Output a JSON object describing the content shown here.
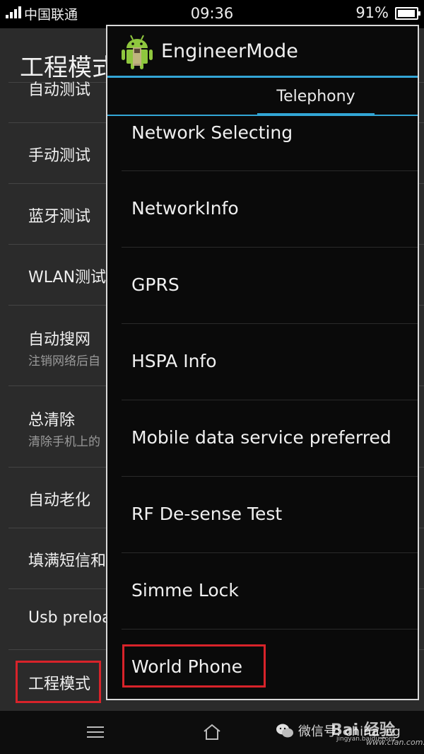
{
  "status_bar": {
    "carrier": "中国联通",
    "time": "09:36",
    "battery": "91%"
  },
  "background_app": {
    "title": "工程模式",
    "items": [
      {
        "label": "自动测试",
        "sub": ""
      },
      {
        "label": "手动测试",
        "sub": ""
      },
      {
        "label": "蓝牙测试",
        "sub": ""
      },
      {
        "label": "WLAN测试",
        "sub": ""
      },
      {
        "label": "自动搜网",
        "sub": "注销网络后自"
      },
      {
        "label": "总清除",
        "sub": "清除手机上的"
      },
      {
        "label": "自动老化",
        "sub": ""
      },
      {
        "label": "填满短信和",
        "sub": ""
      },
      {
        "label": "Usb preloa",
        "sub": ""
      },
      {
        "label": "工程模式",
        "sub": ""
      }
    ]
  },
  "dialog": {
    "title": "EngineerMode",
    "app_icon": "android-robot-icon",
    "tab": "Telephony",
    "items": [
      "Network Selecting",
      "NetworkInfo",
      "GPRS",
      "HSPA Info",
      "Mobile data service preferred",
      "RF De-sense Test",
      "Simme Lock",
      "World Phone"
    ]
  },
  "nav_bar": {
    "icons": [
      "menu-icon",
      "home-icon"
    ]
  },
  "watermark": {
    "wechat_text": "微信号: china_cg",
    "baidu_logo": "Bai 经验",
    "baidu_url": "jingyan.baidu.com",
    "cfan_url": "www.cfan.com.cn"
  },
  "colors": {
    "accent": "#33a6d6",
    "highlight": "#d8232a",
    "dialog_bg": "#0a0a0a",
    "list_bg": "#2b2b2b"
  }
}
